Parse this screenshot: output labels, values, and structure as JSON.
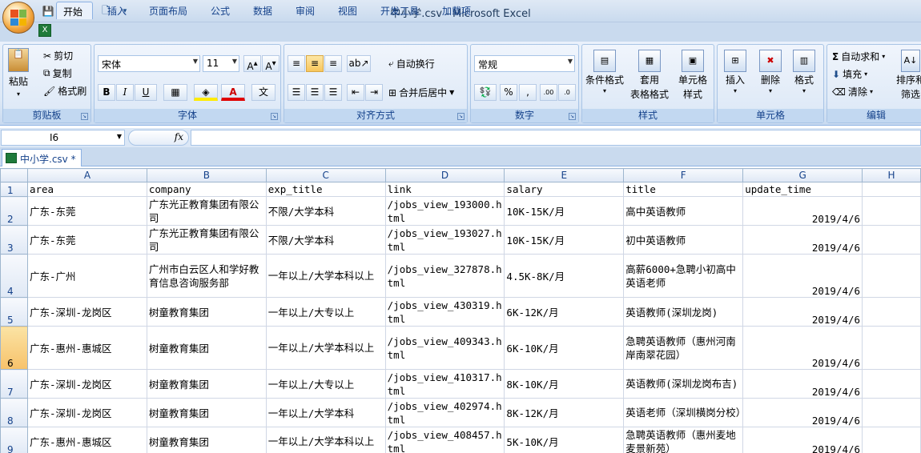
{
  "window": {
    "title": "中小学.csv - Microsoft Excel"
  },
  "qat": {
    "icons": [
      "save-icon",
      "undo-icon",
      "redo-icon",
      "print-preview-icon",
      "customize-icon"
    ]
  },
  "ribbon_tabs": [
    "开始",
    "插入",
    "页面布局",
    "公式",
    "数据",
    "审阅",
    "视图",
    "开发工具",
    "加载项"
  ],
  "clipboard": {
    "paste": "粘贴",
    "cut": "剪切",
    "copy": "复制",
    "format_painter": "格式刷",
    "label": "剪贴板"
  },
  "font": {
    "name": "宋体",
    "size": "11",
    "label": "字体",
    "bold": "B",
    "italic": "I",
    "underline": "U",
    "font_color": "A",
    "phonetic": "文"
  },
  "alignment": {
    "wrap_text": "自动换行",
    "merge_center": "合并后居中",
    "label": "对齐方式"
  },
  "number": {
    "format": "常规",
    "percent": "%",
    "comma": ",",
    "label": "数字"
  },
  "styles": {
    "conditional": "条件格式",
    "table_format_1": "套用",
    "table_format_2": "表格格式",
    "cell_styles_1": "单元格",
    "cell_styles_2": "样式",
    "label": "样式"
  },
  "cells": {
    "insert": "插入",
    "delete": "删除",
    "format": "格式",
    "label": "单元格"
  },
  "editing": {
    "autosum": "自动求和",
    "fill": "填充",
    "clear": "清除",
    "sort_1": "排序和",
    "sort_2": "筛选",
    "label": "编辑"
  },
  "formula_bar": {
    "name_box": "I6",
    "fx": "fx",
    "content": ""
  },
  "workbook_tab": "中小学.csv *",
  "sheet": {
    "columns": [
      "A",
      "B",
      "C",
      "D",
      "E",
      "F",
      "G",
      "H"
    ],
    "rows": [
      {
        "n": "1",
        "cells": [
          "area",
          "company",
          "exp_title",
          "link",
          "salary",
          "title",
          "update_time",
          ""
        ]
      },
      {
        "n": "2",
        "cells": [
          "广东-东莞",
          "广东光正教育集团有限公司",
          "不限/大学本科",
          "/jobs_view_193000.html",
          "10K-15K/月",
          "高中英语教师",
          "2019/4/6",
          ""
        ]
      },
      {
        "n": "3",
        "cells": [
          "广东-东莞",
          "广东光正教育集团有限公司",
          "不限/大学本科",
          "/jobs_view_193027.html",
          "10K-15K/月",
          "初中英语教师",
          "2019/4/6",
          ""
        ]
      },
      {
        "n": "4",
        "cells": [
          "广东-广州",
          "广州市白云区人和学好教育信息咨询服务部",
          "一年以上/大学本科以上",
          "/jobs_view_327878.html",
          "4.5K-8K/月",
          "高薪6000+急聘小初高中英语老师",
          "2019/4/6",
          ""
        ]
      },
      {
        "n": "5",
        "cells": [
          "广东-深圳-龙岗区",
          "树童教育集团",
          "一年以上/大专以上",
          "/jobs_view_430319.html",
          "6K-12K/月",
          "英语教师(深圳龙岗)",
          "2019/4/6",
          ""
        ]
      },
      {
        "n": "6",
        "cells": [
          "广东-惠州-惠城区",
          "树童教育集团",
          "一年以上/大学本科以上",
          "/jobs_view_409343.html",
          "6K-10K/月",
          "急聘英语教师（惠州河南岸南翠花园）",
          "2019/4/6",
          ""
        ]
      },
      {
        "n": "7",
        "cells": [
          "广东-深圳-龙岗区",
          "树童教育集团",
          "一年以上/大专以上",
          "/jobs_view_410317.html",
          "8K-10K/月",
          "英语教师(深圳龙岗布吉)",
          "2019/4/6",
          ""
        ]
      },
      {
        "n": "8",
        "cells": [
          "广东-深圳-龙岗区",
          "树童教育集团",
          "一年以上/大学本科",
          "/jobs_view_402974.html",
          "8K-12K/月",
          "英语老师（深圳横岗分校）",
          "2019/4/6",
          ""
        ]
      },
      {
        "n": "9",
        "cells": [
          "广东-惠州-惠城区",
          "树童教育集团",
          "一年以上/大学本科以上",
          "/jobs_view_408457.html",
          "5K-10K/月",
          "急聘英语教师（惠州麦地麦景新苑）",
          "2019/4/6",
          ""
        ]
      }
    ]
  }
}
